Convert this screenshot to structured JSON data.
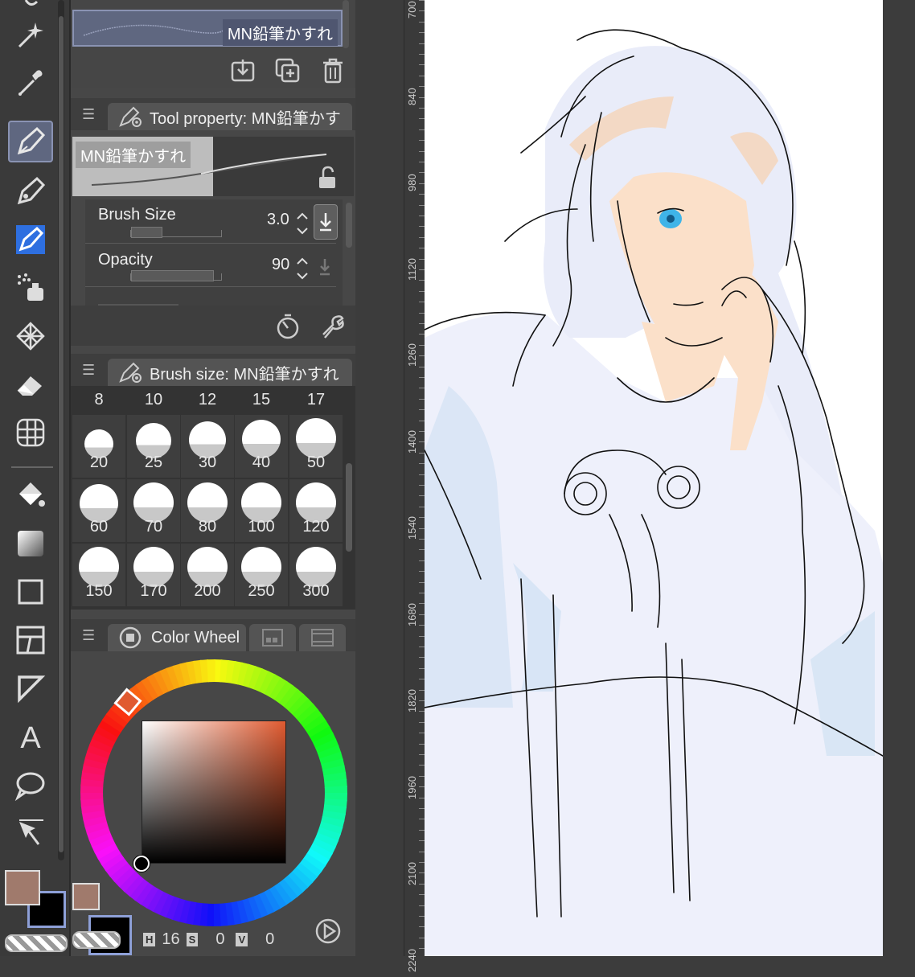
{
  "brush_list": {
    "current_brush": "MN鉛筆かすれ"
  },
  "tool_property": {
    "tab_title": "Tool property: MN鉛筆かす",
    "preview_label": "MN鉛筆かすれ",
    "brush_size": {
      "label": "Brush Size",
      "value": "3.0",
      "slider_fraction": 0.23
    },
    "opacity": {
      "label": "Opacity",
      "value": "90",
      "slider_fraction": 0.9
    }
  },
  "brush_size_panel": {
    "tab_title": "Brush size: MN鉛筆かすれ",
    "top_row": [
      "8",
      "10",
      "12",
      "15",
      "17"
    ],
    "rows": [
      [
        "20",
        "25",
        "30",
        "40",
        "50"
      ],
      [
        "60",
        "70",
        "80",
        "100",
        "120"
      ],
      [
        "150",
        "170",
        "200",
        "250",
        "300"
      ]
    ]
  },
  "color_wheel": {
    "tab_title": "Color Wheel",
    "hue_label": "H",
    "hue_value": "16",
    "sat_label": "S",
    "sat_value": "0",
    "val_label": "V",
    "val_value": "0",
    "main_color": "#a07a6c",
    "sub_color": "#000000",
    "accent": "#e05a30"
  },
  "ruler": {
    "labels": [
      "700",
      "840",
      "980",
      "1120",
      "1260",
      "1400",
      "1540",
      "1680",
      "1820",
      "1960",
      "2100",
      "2240"
    ]
  },
  "icons": [
    "magic-wand-icon",
    "eyedropper-icon",
    "pen-icon",
    "pencil-icon",
    "marker-icon",
    "airbrush-icon",
    "decoration-icon",
    "eraser-icon",
    "blend-icon",
    "fill-icon",
    "gradient-icon",
    "figure-icon",
    "frame-icon",
    "ruler-icon",
    "text-icon",
    "balloon-icon",
    "operation-icon"
  ]
}
